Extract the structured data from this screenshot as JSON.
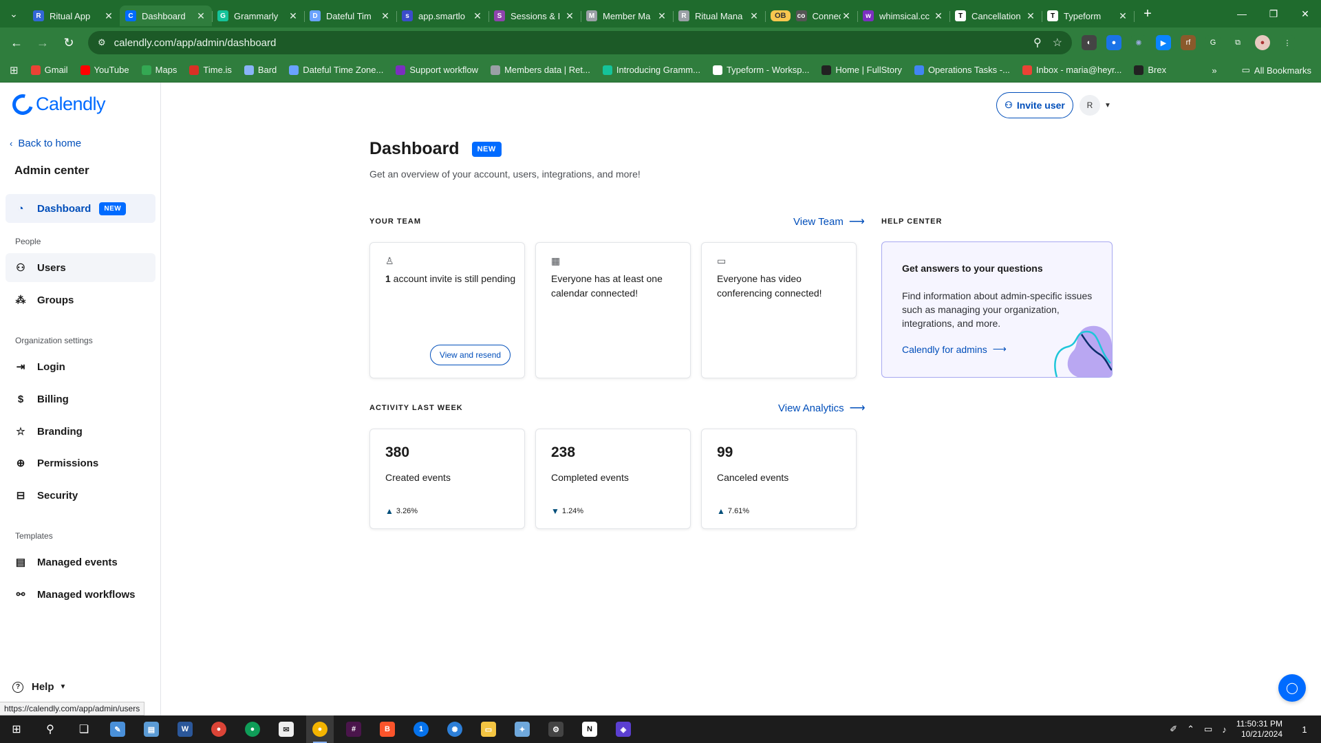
{
  "browser": {
    "tabs": [
      {
        "title": "Ritual App",
        "color": "#3367d6",
        "glyph": "R"
      },
      {
        "title": "Dashboard",
        "color": "#006bff",
        "glyph": "C",
        "active": true
      },
      {
        "title": "Grammarly",
        "color": "#15c39a",
        "glyph": "G"
      },
      {
        "title": "Dateful Tim",
        "color": "#6aa2ff",
        "glyph": "D"
      },
      {
        "title": "app.smartlo",
        "color": "#3b4cca",
        "glyph": "s"
      },
      {
        "title": "Sessions & I",
        "color": "#8e44ad",
        "glyph": "S"
      },
      {
        "title": "Member Ma",
        "color": "#9aa0a6",
        "glyph": "M"
      },
      {
        "title": "Ritual Mana",
        "color": "#9aa0a6",
        "glyph": "R"
      },
      {
        "title": "Connectean",
        "color": "#555555",
        "glyph": "co",
        "pill": "OB"
      },
      {
        "title": "whimsical.cc",
        "color": "#7b2fbf",
        "glyph": "w"
      },
      {
        "title": "Cancellation",
        "color": "#ffffff",
        "glyph": "T"
      },
      {
        "title": "Typeform",
        "color": "#ffffff",
        "glyph": "T"
      }
    ],
    "url": "calendly.com/app/admin/dashboard",
    "bookmarks": [
      {
        "label": "Gmail",
        "color": "#ea4335"
      },
      {
        "label": "YouTube",
        "color": "#ff0000"
      },
      {
        "label": "Maps",
        "color": "#34a853"
      },
      {
        "label": "Time.is",
        "color": "#d93025"
      },
      {
        "label": "Bard",
        "color": "#8ab4f8"
      },
      {
        "label": "Dateful Time Zone...",
        "color": "#6aa2ff"
      },
      {
        "label": "Support workflow",
        "color": "#7b2fbf"
      },
      {
        "label": "Members data | Ret...",
        "color": "#9aa0a6"
      },
      {
        "label": "Introducing Gramm...",
        "color": "#15c39a"
      },
      {
        "label": "Typeform - Worksp...",
        "color": "#ffffff"
      },
      {
        "label": "Home | FullStory",
        "color": "#222222"
      },
      {
        "label": "Operations Tasks -...",
        "color": "#4285f4"
      },
      {
        "label": "Inbox - maria@heyr...",
        "color": "#ea4335"
      },
      {
        "label": "Brex",
        "color": "#222222"
      }
    ],
    "all_bookmarks": "All Bookmarks",
    "status_url": "https://calendly.com/app/admin/users"
  },
  "sidebar": {
    "logo": "Calendly",
    "back": "Back to home",
    "title": "Admin center",
    "dashboard": {
      "label": "Dashboard",
      "badge": "NEW"
    },
    "people_label": "People",
    "users": "Users",
    "groups": "Groups",
    "org_label": "Organization settings",
    "login": "Login",
    "billing": "Billing",
    "branding": "Branding",
    "permissions": "Permissions",
    "security": "Security",
    "templates_label": "Templates",
    "managed_events": "Managed events",
    "managed_workflows": "Managed workflows",
    "help": "Help"
  },
  "header": {
    "invite": "Invite user",
    "avatar": "R"
  },
  "main": {
    "title": "Dashboard",
    "badge": "NEW",
    "subtitle": "Get an overview of your account, users, integrations, and more!",
    "team": {
      "heading": "YOUR TEAM",
      "link": "View Team",
      "cards": [
        {
          "bold": "1",
          "text": " account invite is still pending",
          "button": "View and resend"
        },
        {
          "text": "Everyone has at least one calendar connected!"
        },
        {
          "text": "Everyone has video conferencing connected!"
        }
      ]
    },
    "help": {
      "heading": "HELP CENTER",
      "title": "Get answers to your questions",
      "desc": "Find information about admin-specific issues such as managing your organization, integrations, and more.",
      "link": "Calendly for admins"
    },
    "activity": {
      "heading": "ACTIVITY LAST WEEK",
      "link": "View Analytics",
      "cards": [
        {
          "value": "380",
          "label": "Created events",
          "change": "3.26%",
          "direction": "up"
        },
        {
          "value": "238",
          "label": "Completed events",
          "change": "1.24%",
          "direction": "down"
        },
        {
          "value": "99",
          "label": "Canceled events",
          "change": "7.61%",
          "direction": "up"
        }
      ]
    }
  },
  "taskbar": {
    "time": "11:50:31 PM",
    "date": "10/21/2024",
    "notifications": "1"
  }
}
